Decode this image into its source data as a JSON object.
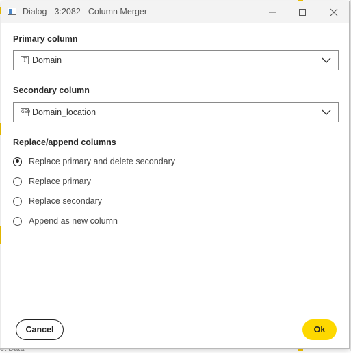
{
  "window": {
    "title": "Dialog - 3:2082 - Column Merger"
  },
  "form": {
    "primary": {
      "label": "Primary column",
      "value": "Domain",
      "type_icon": "T"
    },
    "secondary": {
      "label": "Secondary column",
      "value": "Domain_location",
      "type_icon": "GEO"
    },
    "mode": {
      "label": "Replace/append columns",
      "options": [
        {
          "label": "Replace primary and delete secondary",
          "checked": true
        },
        {
          "label": "Replace primary",
          "checked": false
        },
        {
          "label": "Replace secondary",
          "checked": false
        },
        {
          "label": "Append as new column",
          "checked": false
        }
      ]
    }
  },
  "footer": {
    "cancel_label": "Cancel",
    "ok_label": "Ok"
  },
  "colors": {
    "accent": "#fdd800",
    "titlebar": "#f3f3f3"
  },
  "background": {
    "partial_text": "et Data"
  }
}
